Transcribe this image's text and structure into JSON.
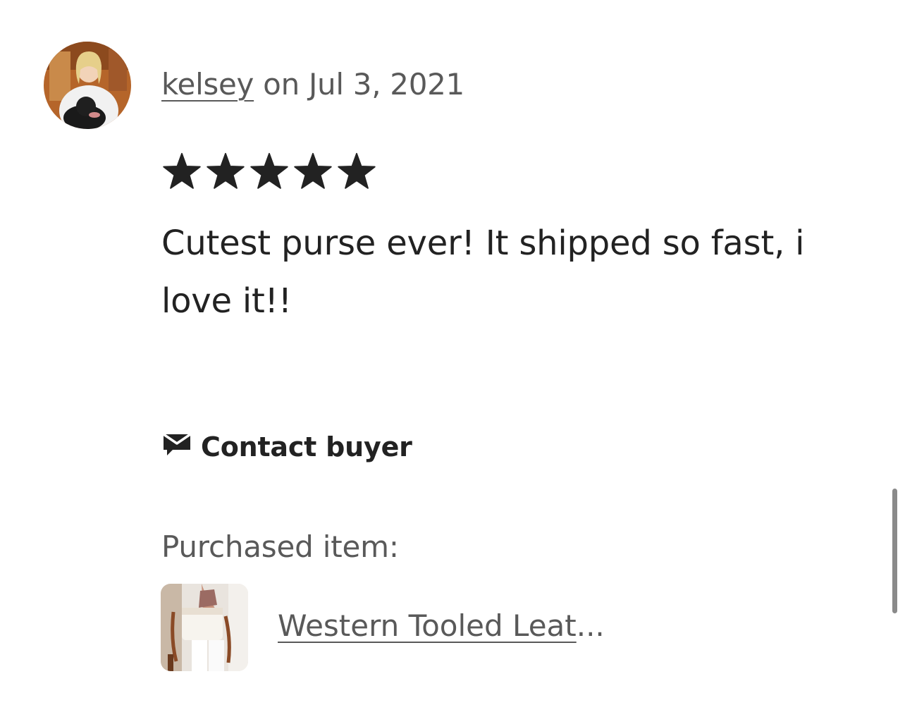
{
  "review": {
    "username": "kelsey",
    "date_text": " on Jul 3, 2021",
    "rating": 5,
    "rating_max": 5,
    "text": "Cutest purse ever! It shipped so fast, i love it!!"
  },
  "contact": {
    "label": "Contact buyer",
    "icon": "message-icon"
  },
  "purchase": {
    "label": "Purchased item:",
    "item_title": "Western Tooled Leat",
    "ellipsis": "..."
  },
  "colors": {
    "text_primary": "#222222",
    "text_secondary": "#595959",
    "star": "#222222",
    "background": "#ffffff",
    "scrollbar": "#8a8a8a"
  }
}
